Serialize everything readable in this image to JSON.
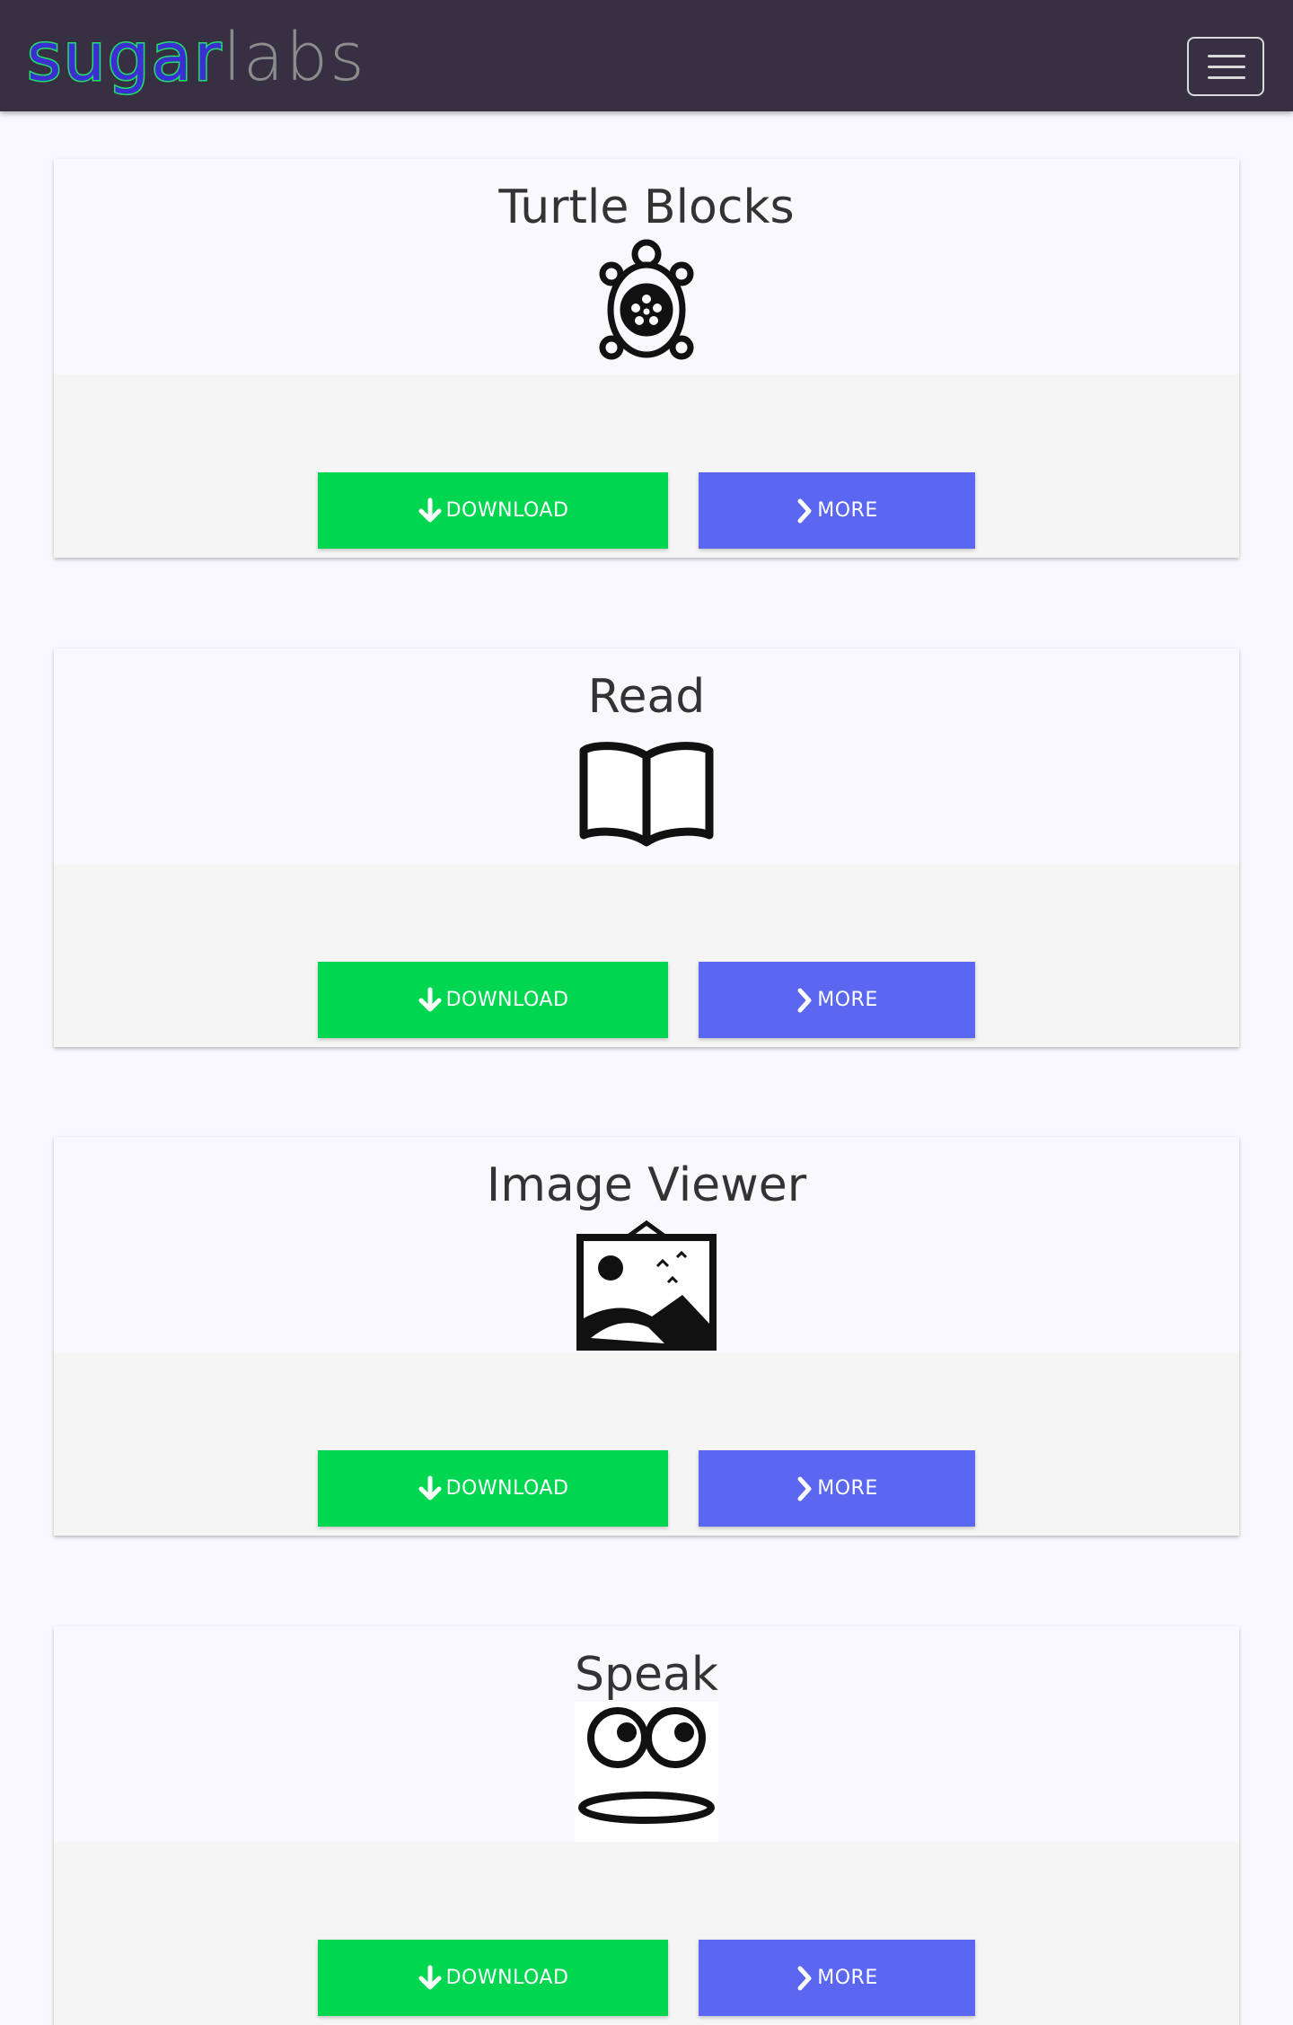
{
  "navbar": {
    "logo_part1": "sugar",
    "logo_part2": "labs",
    "menu_toggle_icon": "hamburger-icon"
  },
  "colors": {
    "navbar_bg": "#372f42",
    "download_button": "#00d650",
    "more_button": "#5b67f0",
    "logo_sugar_outline": "#21e06a",
    "logo_sugar_fill": "#3b2fd1",
    "logo_labs": "#8c8c8c"
  },
  "activities": [
    {
      "title": "Turtle Blocks",
      "icon": "turtle-icon",
      "download_label": "DOWNLOAD",
      "more_label": "MORE"
    },
    {
      "title": "Read",
      "icon": "book-icon",
      "download_label": "DOWNLOAD",
      "more_label": "MORE"
    },
    {
      "title": "Image Viewer",
      "icon": "image-viewer-icon",
      "download_label": "DOWNLOAD",
      "more_label": "MORE"
    },
    {
      "title": "Speak",
      "icon": "speak-face-icon",
      "download_label": "DOWNLOAD",
      "more_label": "MORE"
    }
  ]
}
